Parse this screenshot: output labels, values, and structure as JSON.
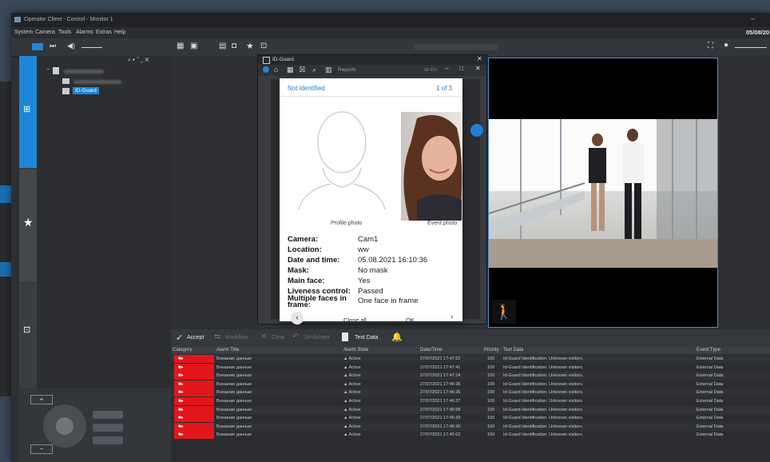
{
  "window": {
    "title": "Operator Client - Control - Monitor 1",
    "date": "05/08/20"
  },
  "menu": [
    "System",
    "Camera",
    "Tools",
    "Alarms",
    "Extras",
    "Help"
  ],
  "tree": {
    "selected_item": "ID-Guard"
  },
  "id_guard": {
    "title": "ID-Guard",
    "reports_label": "Reports",
    "panel_tag": "Id-Gu"
  },
  "dialog": {
    "status": "Not identified",
    "counter": "1 of 3",
    "profile_caption": "Profile photo",
    "event_caption": "Event photo",
    "fields": [
      {
        "label": "Camera:",
        "value": "Cam1"
      },
      {
        "label": "Location:",
        "value": "ww"
      },
      {
        "label": "Date and time:",
        "value": "05.08.2021 16:10:36"
      },
      {
        "label": "Mask:",
        "value": "No mask"
      },
      {
        "label": "Main face:",
        "value": "Yes"
      },
      {
        "label": "Liveness control:",
        "value": "Passed"
      },
      {
        "label": "Multiple faces in frame:",
        "value": "One face in frame"
      }
    ],
    "close_all_label": "Close all",
    "ok_label": "OK"
  },
  "alarm_toolbar": {
    "accept": "Accept",
    "workflow": "Workflow",
    "clear": "Clear",
    "unaccept": "Un-Accept",
    "text_data": "Text Data"
  },
  "alarm_columns": [
    "Category",
    "Alarm Title",
    "Alarm State",
    "Date/Time",
    "Priority",
    "Text Data",
    "Event Type"
  ],
  "alarms": [
    {
      "title": "Внешние данные",
      "state": "Active",
      "datetime": "27/07/2021 17:47:52",
      "priority": "100",
      "text": "Id-Guard Identification. Unknown visitors.",
      "event": "External Data"
    },
    {
      "title": "Внешние данные",
      "state": "Active",
      "datetime": "27/07/2021 17:47:41",
      "priority": "100",
      "text": "Id-Guard Identification. Unknown visitors.",
      "event": "External Data"
    },
    {
      "title": "Внешние данные",
      "state": "Active",
      "datetime": "27/07/2021 17:47:14",
      "priority": "100",
      "text": "Id-Guard Identification. Unknown visitors.",
      "event": "External Data"
    },
    {
      "title": "Внешние данные",
      "state": "Active",
      "datetime": "27/07/2021 17:46:36",
      "priority": "100",
      "text": "Id-Guard Identification. Unknown visitors.",
      "event": "External Data"
    },
    {
      "title": "Внешние данные",
      "state": "Active",
      "datetime": "27/07/2021 17:46:36",
      "priority": "100",
      "text": "Id-Guard Identification. Unknown visitors.",
      "event": "External Data"
    },
    {
      "title": "Внешние данные",
      "state": "Active",
      "datetime": "27/07/2021 17:46:27",
      "priority": "100",
      "text": "Id-Guard Identification. Unknown visitors.",
      "event": "External Data"
    },
    {
      "title": "Внешние данные",
      "state": "Active",
      "datetime": "27/07/2021 17:45:58",
      "priority": "100",
      "text": "Id-Guard Identification. Unknown visitors.",
      "event": "External Data"
    },
    {
      "title": "Внешние данные",
      "state": "Active",
      "datetime": "27/07/2021 17:45:39",
      "priority": "100",
      "text": "Id-Guard Identification. Unknown visitors.",
      "event": "External Data"
    },
    {
      "title": "Внешние данные",
      "state": "Active",
      "datetime": "27/07/2021 17:45:30",
      "priority": "100",
      "text": "Id-Guard Identification. Unknown visitors.",
      "event": "External Data"
    },
    {
      "title": "Внешние данные",
      "state": "Active",
      "datetime": "27/07/2021 17:45:02",
      "priority": "100",
      "text": "Id-Guard Identification. Unknown visitors.",
      "event": "External Data"
    }
  ],
  "colors": {
    "accent": "#1e86d6",
    "alarm_red": "#e3161c",
    "dialog_blue": "#1e7fd0"
  }
}
